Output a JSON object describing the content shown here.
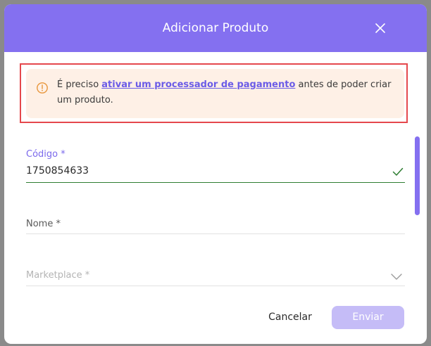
{
  "dialog": {
    "title": "Adicionar Produto",
    "close_icon": "close-icon",
    "accent_color": "#8470f0"
  },
  "alert": {
    "icon": "warning-circle-icon",
    "text_before": "É preciso ",
    "link_text": "ativar um processador de pagamento",
    "text_after": " antes de poder criar um produto.",
    "background_color": "#fef0e6",
    "highlight_color": "#e5484d"
  },
  "form": {
    "codigo": {
      "label": "Código *",
      "value": "1750854633",
      "status_icon": "check-icon"
    },
    "nome": {
      "label": "Nome *",
      "value": ""
    },
    "marketplace": {
      "label": "Marketplace *",
      "icon": "chevron-down-icon"
    }
  },
  "actions": {
    "cancel_label": "Cancelar",
    "submit_label": "Enviar"
  }
}
